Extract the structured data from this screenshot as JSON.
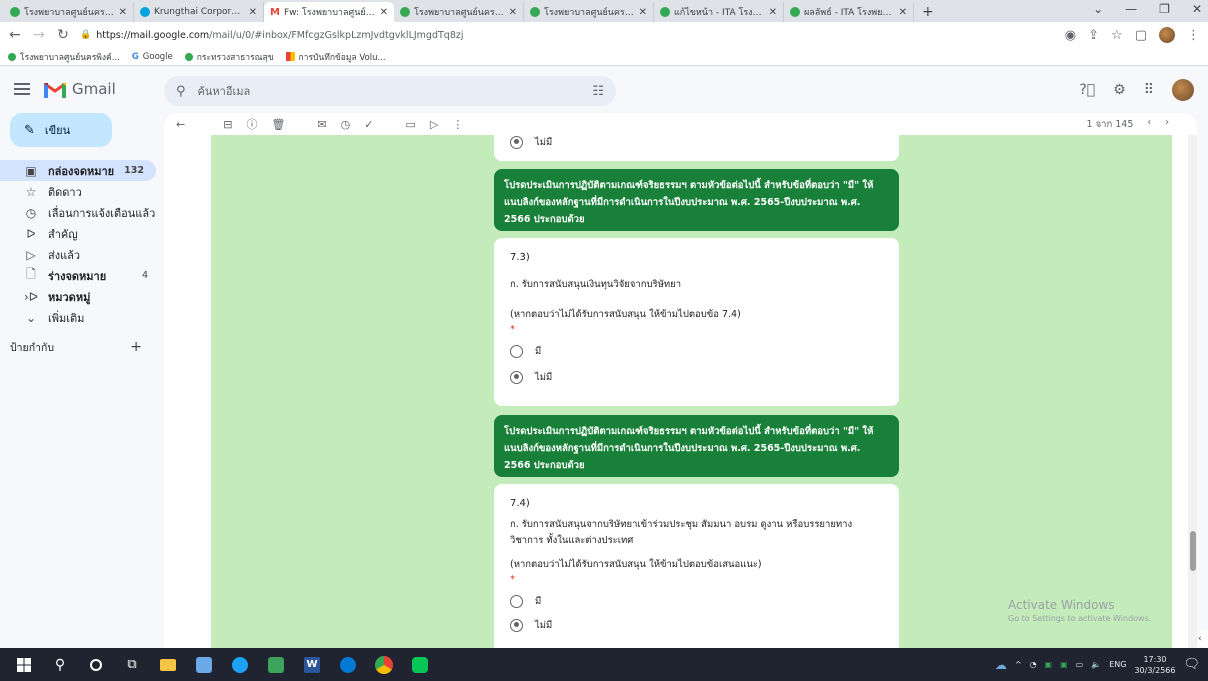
{
  "browser": {
    "tabs": [
      {
        "label": "โรงพยาบาลศูนย์นครพิงค์...",
        "icon": "green-circle-icon",
        "active": false
      },
      {
        "label": "Krungthai Corporate Online",
        "icon": "krungthai-icon",
        "active": false
      },
      {
        "label": "Fw: โรงพยาบาลศูนย์ โรงพยาบาลทั่วไป",
        "icon": "gmail-icon",
        "active": true
      },
      {
        "label": "โรงพยาบาลศูนย์นครพิงค์ | ...",
        "icon": "green-circle-icon",
        "active": false
      },
      {
        "label": "โรงพยาบาลศูนย์นครพิงค์ - ...",
        "icon": "green-circle-icon",
        "active": false
      },
      {
        "label": "แก้ไขหน้า - ITA โรงพยาบาล...",
        "icon": "green-circle-icon",
        "active": false
      },
      {
        "label": "ผลลัพธ์ - ITA โรงพยาบาล...",
        "icon": "green-circle-icon",
        "active": false
      }
    ],
    "url_host": "https://mail.google.com",
    "url_path": "/mail/u/0/#inbox/FMfcgzGslkpLzmJvdtgvklLJmgdTq8zj",
    "bookmarks": [
      {
        "label": "โรงพยาบาลศูนย์นครพิงค์...",
        "icon": "green-circle-icon"
      },
      {
        "label": "Google",
        "icon": "google-icon"
      },
      {
        "label": "กระทรวงสาธารณสุข",
        "icon": "green-circle-icon"
      },
      {
        "label": "การบันทึกข้อมูล Volu...",
        "icon": "apps-grid-icon"
      }
    ]
  },
  "gmail": {
    "app_name": "Gmail",
    "search_placeholder": "ค้นหาอีเมล",
    "compose_label": "เขียน",
    "nav": [
      {
        "label": "กล่องจดหมาย",
        "count": "132",
        "icon": "inbox-icon",
        "active": true,
        "bold": true
      },
      {
        "label": "ติดดาว",
        "count": "",
        "icon": "star-icon",
        "active": false,
        "bold": false
      },
      {
        "label": "เลื่อนการแจ้งเตือนแล้ว",
        "count": "",
        "icon": "clock-icon",
        "active": false,
        "bold": false
      },
      {
        "label": "สำคัญ",
        "count": "",
        "icon": "label-important-icon",
        "active": false,
        "bold": false
      },
      {
        "label": "ส่งแล้ว",
        "count": "",
        "icon": "send-icon",
        "active": false,
        "bold": false
      },
      {
        "label": "ร่างจดหมาย",
        "count": "4",
        "icon": "draft-icon",
        "active": false,
        "bold": true
      },
      {
        "label": "หมวดหมู่",
        "count": "",
        "icon": "category-icon",
        "active": false,
        "bold": true
      },
      {
        "label": "เพิ่มเติม",
        "count": "",
        "icon": "chevron-down-icon",
        "active": false,
        "bold": false
      }
    ],
    "labels_heading": "ป้ายกำกับ",
    "pager": "1 จาก 145"
  },
  "form": {
    "top_option": "ไม่มี",
    "banner_text": "โปรดประเมินการปฏิบัติตามเกณฑ์จริยธรรมฯ ตามหัวข้อต่อไปนี้ สำหรับข้อที่ตอบว่า \"มี\" ให้แนบลิงก์ของหลักฐานที่มีการดำเนินการในปีงบประมาณ พ.ศ. 2565-ปีงบประมาณ พ.ศ. 2566 ประกอบด้วย",
    "q73": {
      "number": "7.3)",
      "text": "ก. รับการสนับสนุนเงินทุนวิจัยจากบริษัทยา",
      "note": "(หากตอบว่าไม่ได้รับการสนับสนุน ให้ข้ามไปตอบข้อ 7.4)",
      "required": "*",
      "options": [
        {
          "label": "มี",
          "selected": false
        },
        {
          "label": "ไม่มี",
          "selected": true
        }
      ]
    },
    "q74": {
      "number": "7.4)",
      "text": "ก. รับการสนับสนุนจากบริษัทยาเข้าร่วมประชุม สัมมนา อบรม ดูงาน หรือบรรยายทางวิชาการ ทั้งในและต่างประเทศ",
      "note": "(หากตอบว่าไม่ได้รับการสนับสนุน ให้ข้ามไปตอบข้อเสนอแนะ)",
      "required": "*",
      "options": [
        {
          "label": "มี",
          "selected": false
        },
        {
          "label": "ไม่มี",
          "selected": true
        }
      ]
    }
  },
  "watermark": {
    "title": "Activate Windows",
    "subtitle": "Go to Settings to activate Windows."
  },
  "system": {
    "time": "17:30",
    "date": "30/3/2566",
    "lang": "ENG"
  },
  "colors": {
    "banner": "#188038",
    "content_bg": "#c4ecbb",
    "compose": "#c2e7ff",
    "active_nav": "#d3e3fd"
  }
}
